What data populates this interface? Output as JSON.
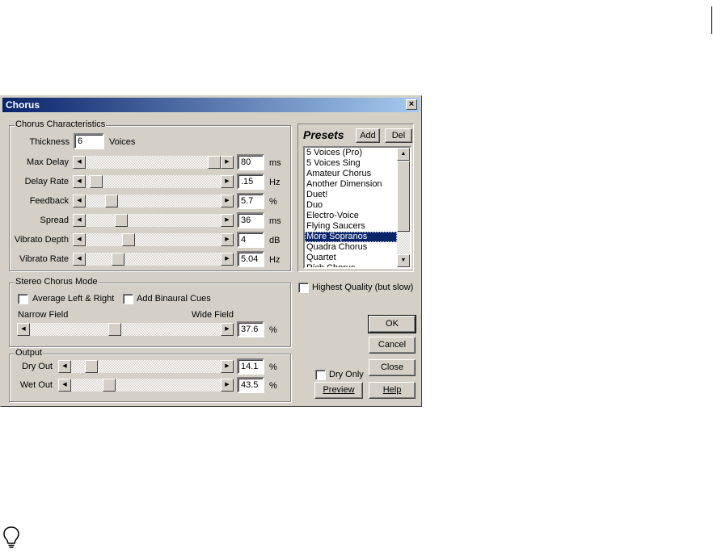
{
  "window": {
    "title": "Chorus",
    "close_glyph": "×"
  },
  "chorus_characteristics": {
    "group_label": "Chorus Characteristics",
    "thickness": {
      "label": "Thickness",
      "value": "6",
      "unit": "Voices"
    },
    "sliders": [
      {
        "label": "Max Delay",
        "value": "80",
        "unit": "ms",
        "position": 1.0
      },
      {
        "label": "Delay Rate",
        "value": ".15",
        "unit": "Hz",
        "position": 0.03
      },
      {
        "label": "Feedback",
        "value": "5.7",
        "unit": "%",
        "position": 0.16
      },
      {
        "label": "Spread",
        "value": "36",
        "unit": "ms",
        "position": 0.24
      },
      {
        "label": "Vibrato Depth",
        "value": "4",
        "unit": "dB",
        "position": 0.3
      },
      {
        "label": "Vibrato Rate",
        "value": "5.04",
        "unit": "Hz",
        "position": 0.21
      }
    ]
  },
  "stereo_mode": {
    "group_label": "Stereo Chorus Mode",
    "average_lr": {
      "label": "Average Left & Right",
      "checked": false
    },
    "binaural": {
      "label": "Add Binaural Cues",
      "checked": false
    },
    "narrow_label": "Narrow Field",
    "wide_label": "Wide Field",
    "field": {
      "value": "37.6",
      "unit": "%",
      "position": 0.44
    }
  },
  "output": {
    "group_label": "Output",
    "sliders": [
      {
        "label": "Dry Out",
        "value": "14.1",
        "unit": "%",
        "position": 0.1
      },
      {
        "label": "Wet Out",
        "value": "43.5",
        "unit": "%",
        "position": 0.23
      }
    ]
  },
  "presets": {
    "title": "Presets",
    "add_label": "Add",
    "del_label": "Del",
    "items": [
      "5 Voices (Pro)",
      "5 Voices Sing",
      "Amateur Chorus",
      "Another Dimension",
      "Duet!",
      "Duo",
      "Electro-Voice",
      "Flying Saucers",
      "More Sopranos",
      "Quadra Chorus",
      "Quartet",
      "Rich Chorus"
    ],
    "selected_index": 8
  },
  "highest_quality": {
    "label": "Highest Quality (but slow)",
    "checked": false
  },
  "dry_only": {
    "label": "Dry Only",
    "checked": false
  },
  "buttons": {
    "ok": "OK",
    "cancel": "Cancel",
    "close": "Close",
    "preview": "Preview",
    "help": "Help"
  },
  "glyphs": {
    "left": "◀",
    "right": "▶",
    "up": "▲",
    "down": "▼"
  },
  "icons": {
    "tip": "lightbulb-icon"
  }
}
